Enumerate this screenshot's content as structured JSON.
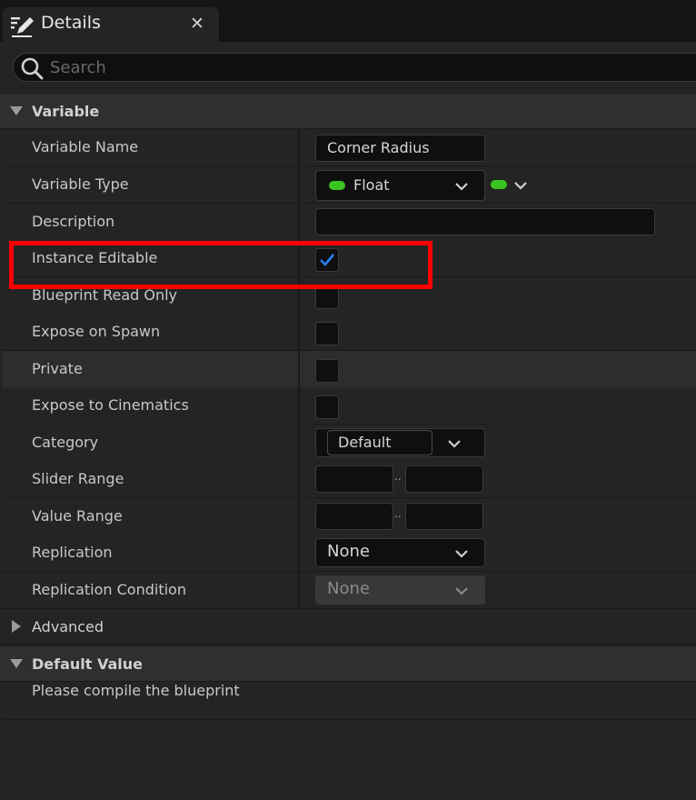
{
  "tab": {
    "title": "Details",
    "close_glyph": "✕",
    "icon": "pencil-icon"
  },
  "search": {
    "placeholder": "Search",
    "value": ""
  },
  "sections": {
    "variable": {
      "label": "Variable",
      "expanded": true
    },
    "advanced": {
      "label": "Advanced",
      "expanded": false
    },
    "default_value": {
      "label": "Default Value",
      "expanded": true
    }
  },
  "properties": {
    "variable_name": {
      "label": "Variable Name",
      "value": "Corner Radius"
    },
    "variable_type": {
      "label": "Variable Type",
      "value": "Float",
      "pin_color": "#39c41f"
    },
    "description": {
      "label": "Description",
      "value": ""
    },
    "instance_editable": {
      "label": "Instance Editable",
      "checked": true
    },
    "blueprint_read_only": {
      "label": "Blueprint Read Only",
      "checked": false
    },
    "expose_on_spawn": {
      "label": "Expose on Spawn",
      "checked": false
    },
    "private": {
      "label": "Private",
      "checked": false
    },
    "expose_to_cinematics": {
      "label": "Expose to Cinematics",
      "checked": false
    },
    "category": {
      "label": "Category",
      "value": "Default"
    },
    "slider_range": {
      "label": "Slider Range",
      "sep": "..",
      "min": "",
      "max": ""
    },
    "value_range": {
      "label": "Value Range",
      "sep": "..",
      "min": "",
      "max": ""
    },
    "replication": {
      "label": "Replication",
      "value": "None"
    },
    "replication_condition": {
      "label": "Replication Condition",
      "value": "None",
      "disabled": true
    }
  },
  "default_value_note": "Please compile the blueprint",
  "colors": {
    "accent_check": "#2a7ff0",
    "highlight": "#ff0000",
    "float_pin": "#39c41f"
  }
}
